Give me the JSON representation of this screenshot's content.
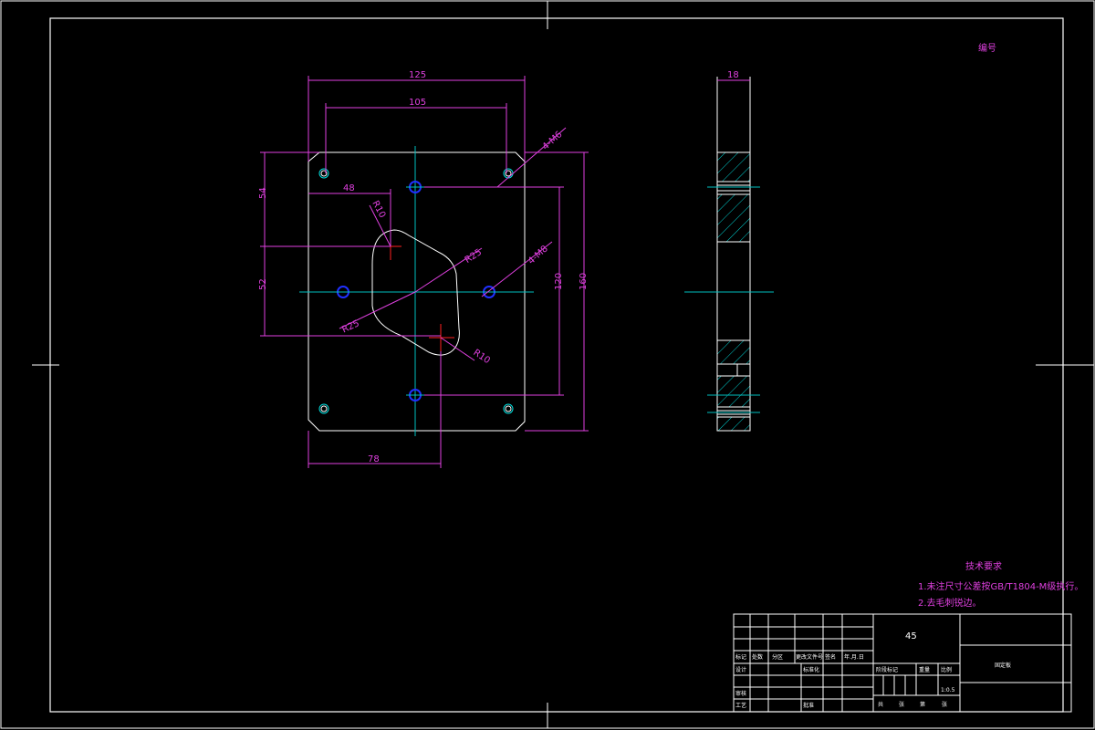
{
  "colors": {
    "background": "#000000",
    "outline": "#ffffff",
    "dimension": "#e040e0",
    "centerline": "#00c0c0",
    "hole": "#2030ff",
    "hatch": "#00d0d0",
    "marker": "#ff2020"
  },
  "corner_mark": "编号",
  "front_view": {
    "dims": {
      "width_outer": "125",
      "width_inner": "105",
      "holes_m6": "4-M6",
      "holes_m8": "4-M8",
      "offset_48": "48",
      "radius_r10_top": "R10",
      "radius_r25_right": "R25",
      "radius_r25_left": "R25",
      "radius_r10_bottom": "R10",
      "height_54": "54",
      "height_52": "52",
      "height_120": "120",
      "height_160": "160",
      "offset_78": "78"
    }
  },
  "side_view": {
    "dims": {
      "thickness": "18"
    }
  },
  "tech_requirements": {
    "title": "技术要求",
    "item1": "1.未注尺寸公差按GB/T1804-M级执行。",
    "item2": "2.去毛刺锐边。"
  },
  "title_block": {
    "material": "45",
    "part_name": "固定板",
    "scale": "1:0.5",
    "row_labels": {
      "mark": "标记",
      "count": "处数",
      "zone": "分区",
      "change_doc": "更改文件号",
      "sign": "签名",
      "date": "年.月.日",
      "design": "设计",
      "standard": "标准化",
      "review": "审核",
      "craft": "工艺",
      "approve": "批准"
    },
    "right_labels": {
      "stage": "阶段标记",
      "weight": "重量",
      "scale_label": "比例",
      "sheets": "共",
      "sheet": "张",
      "page": "第",
      "page_unit": "张"
    }
  }
}
